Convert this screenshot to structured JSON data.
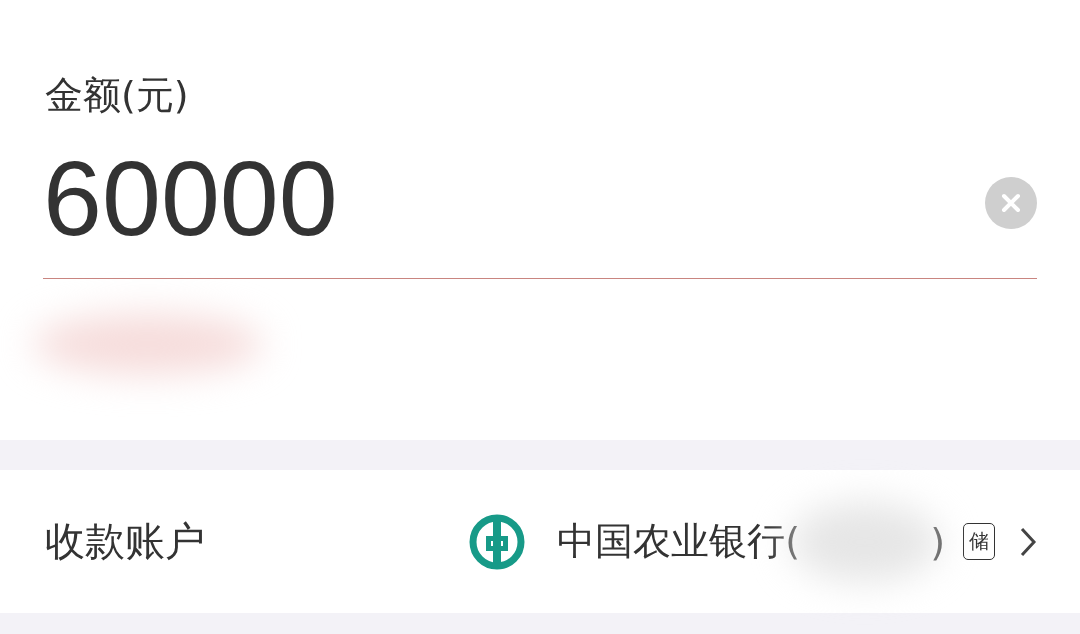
{
  "amount": {
    "label": "金额(元)",
    "value": "60000"
  },
  "account": {
    "label": "收款账户",
    "bank": "中国农业银行(",
    "suffix": ")",
    "badge": "储"
  }
}
